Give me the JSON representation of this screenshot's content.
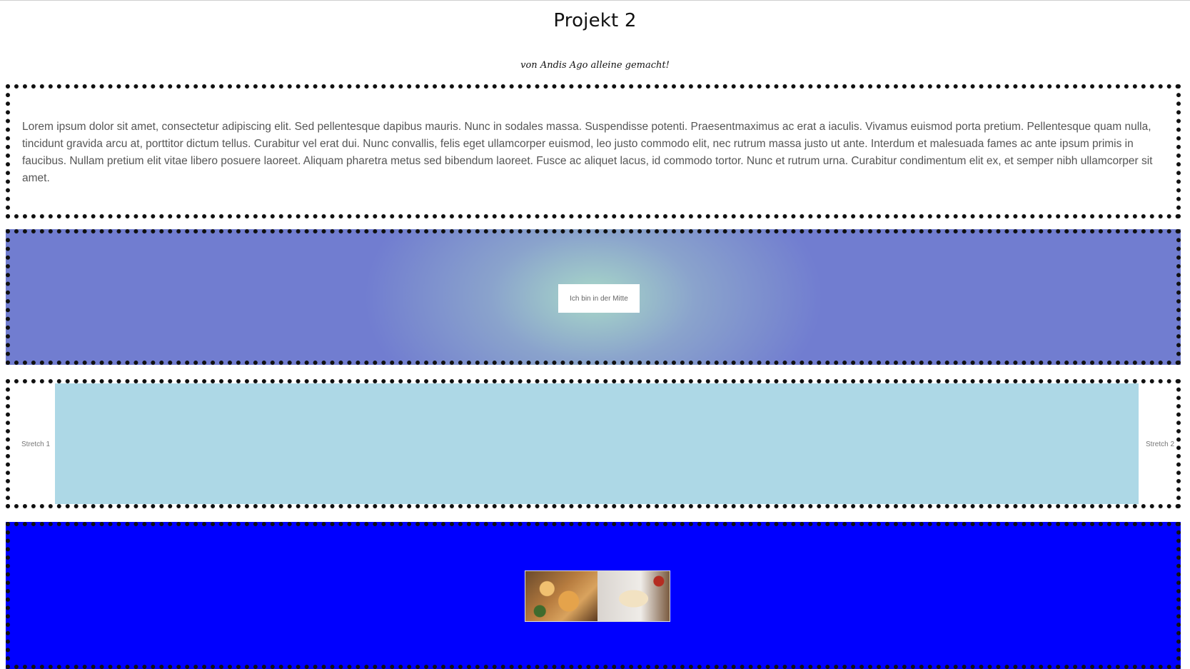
{
  "header": {
    "title": "Projekt 2",
    "subtitle": "von Andis Ago alleine gemacht!"
  },
  "text_section": {
    "paragraph": "Lorem ipsum dolor sit amet, consectetur adipiscing elit. Sed pellentesque dapibus mauris. Nunc in sodales massa. Suspendisse potenti. Praesentmaximus ac erat a iaculis. Vivamus euismod porta pretium. Pellentesque quam nulla, tincidunt gravida arcu at, porttitor dictum tellus. Curabitur vel erat dui. Nunc convallis, felis eget ullamcorper euismod, leo justo commodo elit, nec rutrum massa justo ut ante. Interdum et malesuada fames ac ante ipsum primis in faucibus. Nullam pretium elit vitae libero posuere laoreet. Aliquam pharetra metus sed bibendum laoreet. Fusce ac aliquet lacus, id commodo tortor. Nunc et rutrum urna. Curabitur condimentum elit ex, et semper nibh ullamcorper sit amet."
  },
  "center_section": {
    "card_label": "Ich bin in der Mitte"
  },
  "stretch_section": {
    "left_label": "Stretch 1",
    "right_label": "Stretch 2",
    "fill_color": "#add8e6"
  },
  "image_section": {
    "background_color": "#0000ff",
    "images": [
      "pizza-photo-1",
      "pizza-photo-2"
    ]
  }
}
